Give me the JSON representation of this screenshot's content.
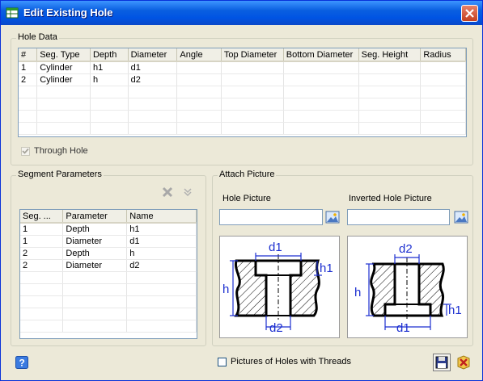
{
  "window": {
    "title": "Edit Existing Hole"
  },
  "hole_data": {
    "legend": "Hole Data",
    "columns": [
      "#",
      "Seg. Type",
      "Depth",
      "Diameter",
      "Angle",
      "Top Diameter",
      "Bottom Diameter",
      "Seg. Height",
      "Radius"
    ],
    "rows": [
      [
        "1",
        "Cylinder",
        "h1",
        "d1",
        "",
        "",
        "",
        "",
        ""
      ],
      [
        "2",
        "Cylinder",
        "h",
        "d2",
        "",
        "",
        "",
        "",
        ""
      ]
    ],
    "through_hole_label": "Through Hole",
    "through_hole_checked": true
  },
  "segment_parameters": {
    "legend": "Segment Parameters",
    "columns": [
      "Seg. ...",
      "Parameter",
      "Name"
    ],
    "rows": [
      [
        "1",
        "Depth",
        "h1"
      ],
      [
        "1",
        "Diameter",
        "d1"
      ],
      [
        "2",
        "Depth",
        "h"
      ],
      [
        "2",
        "Diameter",
        "d2"
      ]
    ]
  },
  "attach_picture": {
    "legend": "Attach Picture",
    "hole_picture_label": "Hole Picture",
    "inverted_hole_picture_label": "Inverted Hole Picture",
    "hole_picture_value": "",
    "inverted_hole_picture_value": "",
    "hole_diagram": {
      "top_label": "d1",
      "bottom_label": "d2",
      "left_label": "h",
      "right_label": "h1"
    },
    "inverted_diagram": {
      "top_label": "d2",
      "bottom_label": "d1",
      "left_label": "h",
      "right_label": "h1"
    }
  },
  "footer": {
    "threads_label": "Pictures of Holes with Threads",
    "threads_checked": false
  },
  "colors": {
    "dimension": "#1c2fd0",
    "accent": "#0054e3"
  }
}
